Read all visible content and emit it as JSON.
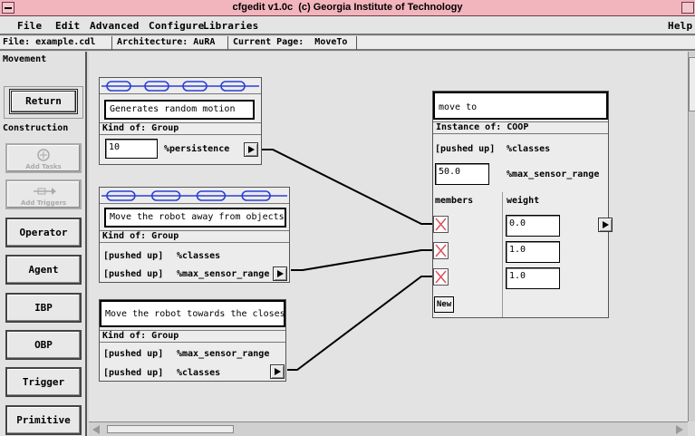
{
  "window": {
    "title": "cfgedit v1.0c  (c) Georgia Institute of Technology"
  },
  "menu": {
    "file": "File",
    "edit": "Edit",
    "advanced": "Advanced",
    "configure": "Configure",
    "libraries": "Libraries",
    "help": "Help"
  },
  "infobar": {
    "file": "File: example.cdl",
    "architecture": "Architecture: AuRA",
    "page": "Current Page:  MoveTo"
  },
  "palette": {
    "movement_label": "Movement",
    "return": "Return",
    "construction_label": "Construction",
    "add_tasks": "Add Tasks",
    "add_triggers": "Add Triggers",
    "operator": "Operator",
    "agent": "Agent",
    "ibp": "IBP",
    "obp": "OBP",
    "trigger": "Trigger",
    "primitive": "Primitive"
  },
  "agents": {
    "random": {
      "description": "Generates random motion",
      "kind": "Kind of: Group",
      "persistence_value": "10",
      "persistence_label": "%persistence"
    },
    "avoid": {
      "description": "Move the robot away from objects",
      "kind": "Kind of: Group",
      "row1_left": "[pushed up]",
      "row1_right": "%classes",
      "row2_left": "[pushed up]",
      "row2_right": "%max_sensor_range"
    },
    "towards": {
      "description": "Move the robot towards the closest",
      "kind": "Kind of: Group",
      "row1_left": "[pushed up]",
      "row1_right": "%max_sensor_range",
      "row2_left": "[pushed up]",
      "row2_right": "%classes"
    },
    "moveto": {
      "name": "move to",
      "instance": "Instance of: COOP",
      "row1_left": "[pushed up]",
      "row1_right": "%classes",
      "range_value": "50.0",
      "range_label": "%max_sensor_range",
      "members_label": "members",
      "weight_label": "weight",
      "weights": [
        "0.0",
        "1.0",
        "1.0"
      ],
      "new_button": "New"
    }
  },
  "colors": {
    "titlebar": "#f2b4bd",
    "chain": "#2a3fd8",
    "member_x": "#e0505c"
  }
}
